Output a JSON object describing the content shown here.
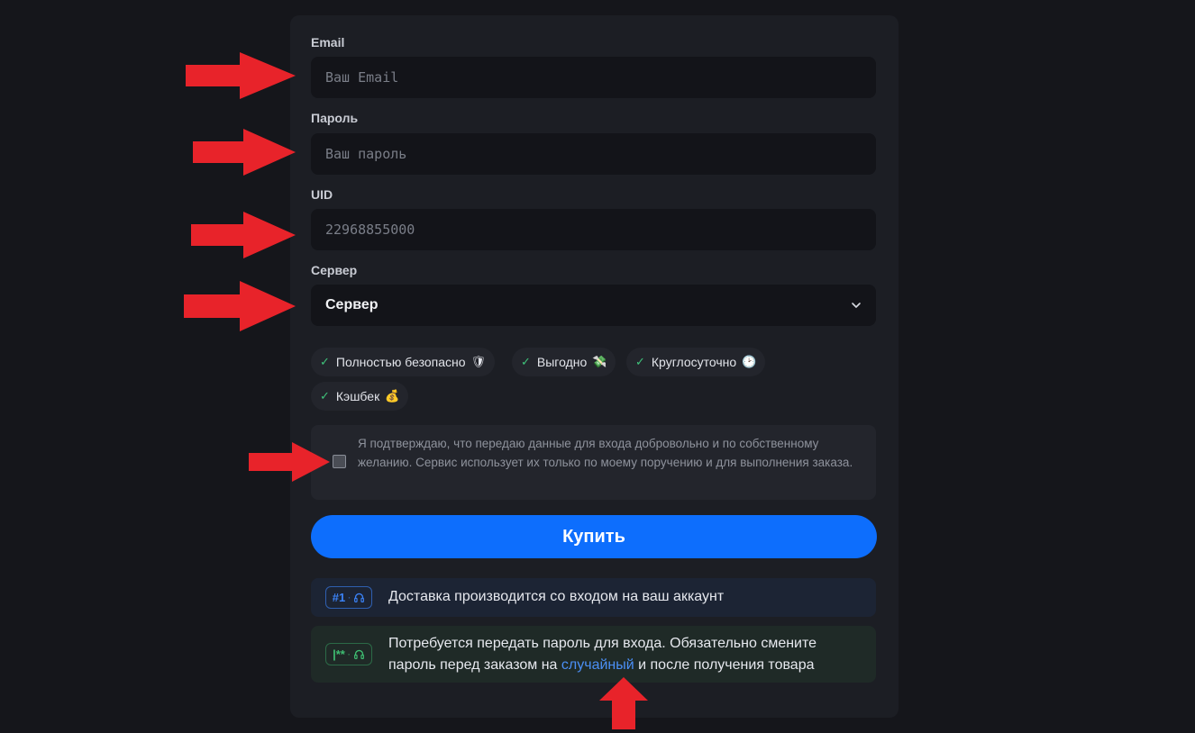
{
  "form": {
    "email": {
      "label": "Email",
      "placeholder": "Ваш Email",
      "value": ""
    },
    "password": {
      "label": "Пароль",
      "placeholder": "Ваш пароль",
      "value": ""
    },
    "uid": {
      "label": "UID",
      "placeholder": "22968855000",
      "value": ""
    },
    "server": {
      "label": "Сервер",
      "selected": "Сервер"
    }
  },
  "chips": [
    {
      "label": "Полностью безопасно",
      "emoji": "🛡"
    },
    {
      "label": "Выгодно",
      "emoji": "💸"
    },
    {
      "label": "Круглосуточно",
      "emoji": "🕑"
    },
    {
      "label": "Кэшбек",
      "emoji": "💰"
    }
  ],
  "consent": {
    "checked": false,
    "text": "Я подтверждаю, что передаю данные для входа добровольно и по собственному желанию. Сервис использует их только по моему поручению и для выполнения заказа."
  },
  "buy_button": {
    "label": "Купить",
    "color": "#0d6efd"
  },
  "info": [
    {
      "badge": "#1",
      "text": "Доставка производится со входом на ваш аккаунт"
    },
    {
      "badge": "|**",
      "text_before": "Потребуется передать пароль для входа. Обязательно смените пароль перед заказом на ",
      "link": "случайный",
      "text_after": " и после получения товара"
    }
  ],
  "icons": {
    "check": "✓",
    "chevron": "chevron-down-icon",
    "headset": "headset-icon",
    "annotation_arrow": "red-arrow-icon"
  },
  "colors": {
    "background": "#15161b",
    "card": "#1c1e24",
    "accent": "#0d6efd",
    "annotation": "#e8232a",
    "success": "#3fc27a"
  }
}
